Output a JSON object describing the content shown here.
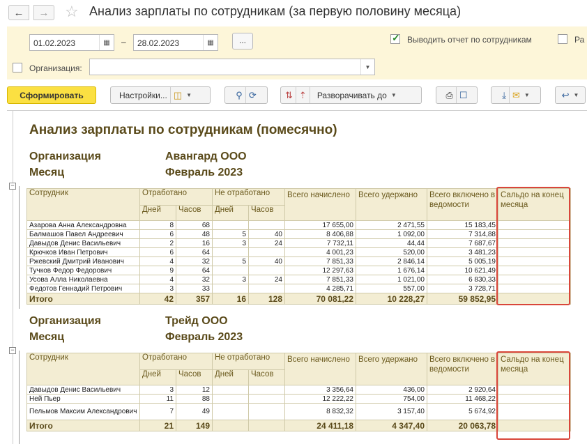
{
  "window": {
    "title": "Анализ зарплаты по сотрудникам (за первую половину месяца)"
  },
  "params": {
    "date_from": "01.02.2023",
    "date_to": "28.02.2023",
    "dash": "–",
    "more_btn": "...",
    "by_employee_label": "Выводить отчет по сотрудникам",
    "by_employee_checked": true,
    "cut_label": "Ра",
    "org_label": "Организация:",
    "org_value": ""
  },
  "toolbar": {
    "generate": "Сформировать",
    "settings": "Настройки...",
    "expand": "Разворачивать до"
  },
  "report": {
    "title": "Анализ зарплаты по сотрудникам (помесячно)",
    "org_label": "Организация",
    "month_label": "Месяц",
    "columns": {
      "employee": "Сотрудник",
      "worked": "Отработано",
      "not_worked": "Не отработано",
      "days": "Дней",
      "hours": "Часов",
      "accrued": "Всего начислено",
      "withheld": "Всего удержано",
      "in_statements": "Всего включено в ведомости",
      "balance": "Сальдо на конец месяца"
    },
    "groups": [
      {
        "org": "Авангард ООО",
        "month": "Февраль 2023",
        "rows": [
          [
            "Азарова Анна Александровна",
            "8",
            "68",
            "",
            "",
            "17 655,00",
            "2 471,55",
            "15 183,45",
            ""
          ],
          [
            "Балмашов Павел Андреевич",
            "6",
            "48",
            "5",
            "40",
            "8 406,88",
            "1 092,00",
            "7 314,88",
            ""
          ],
          [
            "Давыдов Денис Васильевич",
            "2",
            "16",
            "3",
            "24",
            "7 732,11",
            "44,44",
            "7 687,67",
            ""
          ],
          [
            "Крючков Иван Петрович",
            "6",
            "64",
            "",
            "",
            "4 001,23",
            "520,00",
            "3 481,23",
            ""
          ],
          [
            "Ржевский Дмитрий Иванович",
            "4",
            "32",
            "5",
            "40",
            "7 851,33",
            "2 846,14",
            "5 005,19",
            ""
          ],
          [
            "Тучков Федор Федорович",
            "9",
            "64",
            "",
            "",
            "12 297,63",
            "1 676,14",
            "10 621,49",
            ""
          ],
          [
            "Усова Алла Николаевна",
            "4",
            "32",
            "3",
            "24",
            "7 851,33",
            "1 021,00",
            "6 830,33",
            ""
          ],
          [
            "Федотов Геннадий Петрович",
            "3",
            "33",
            "",
            "",
            "4 285,71",
            "557,00",
            "3 728,71",
            ""
          ]
        ],
        "total": [
          "Итого",
          "42",
          "357",
          "16",
          "128",
          "70 081,22",
          "10 228,27",
          "59 852,95",
          ""
        ]
      },
      {
        "org": "Трейд ООО",
        "month": "Февраль 2023",
        "rows": [
          [
            "Давыдов Денис Васильевич",
            "3",
            "12",
            "",
            "",
            "3 356,64",
            "436,00",
            "2 920,64",
            ""
          ],
          [
            "Ней Пьер",
            "11",
            "88",
            "",
            "",
            "12 222,22",
            "754,00",
            "11 468,22",
            ""
          ],
          [
            "Пельмов Максим Александрович",
            "7",
            "49",
            "",
            "",
            "8 832,32",
            "3 157,40",
            "5 674,92",
            ""
          ]
        ],
        "total": [
          "Итого",
          "21",
          "149",
          "",
          "",
          "24 411,18",
          "4 347,40",
          "20 063,78",
          ""
        ]
      }
    ]
  },
  "colors": {
    "accent_yellow": "#fbe042",
    "highlight_red": "#d9463a",
    "header_bg": "#f3edd3",
    "param_bg": "#fdf6d9"
  }
}
